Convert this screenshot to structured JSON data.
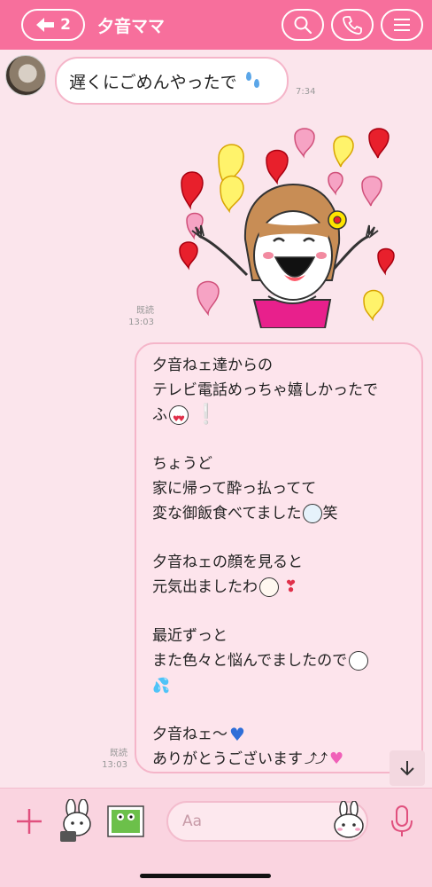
{
  "header": {
    "back_count": "2",
    "title": "夕音ママ",
    "accent": "#f76f9c"
  },
  "messages": {
    "incoming": {
      "text": "遅くにごめんやったで",
      "time": "7:34"
    },
    "sticker_meta": {
      "read": "既読",
      "time": "13:03"
    },
    "outgoing": {
      "read": "既読",
      "time": "13:03",
      "lines": [
        "夕音ねェ達からの",
        "テレビ電話めっちゃ嬉しかったで",
        "ふ",
        "",
        "ちょうど",
        "家に帰って酔っ払ってて",
        "変な御飯食べてました",
        "笑",
        "",
        "夕音ねェの顔を見ると",
        "元気出ましたわ",
        "",
        "最近ずっと",
        "また色々と悩んでましたので",
        "",
        "夕音ねェ〜",
        "ありがとうございます",
        "⤴⤴"
      ]
    }
  },
  "composer": {
    "placeholder": "Aa"
  },
  "icons": {
    "back": "arrow-left-icon",
    "search": "search-icon",
    "call": "phone-icon",
    "menu": "hamburger-menu-icon",
    "plus": "plus-icon",
    "mic": "microphone-icon",
    "scroll": "arrow-down-icon"
  }
}
